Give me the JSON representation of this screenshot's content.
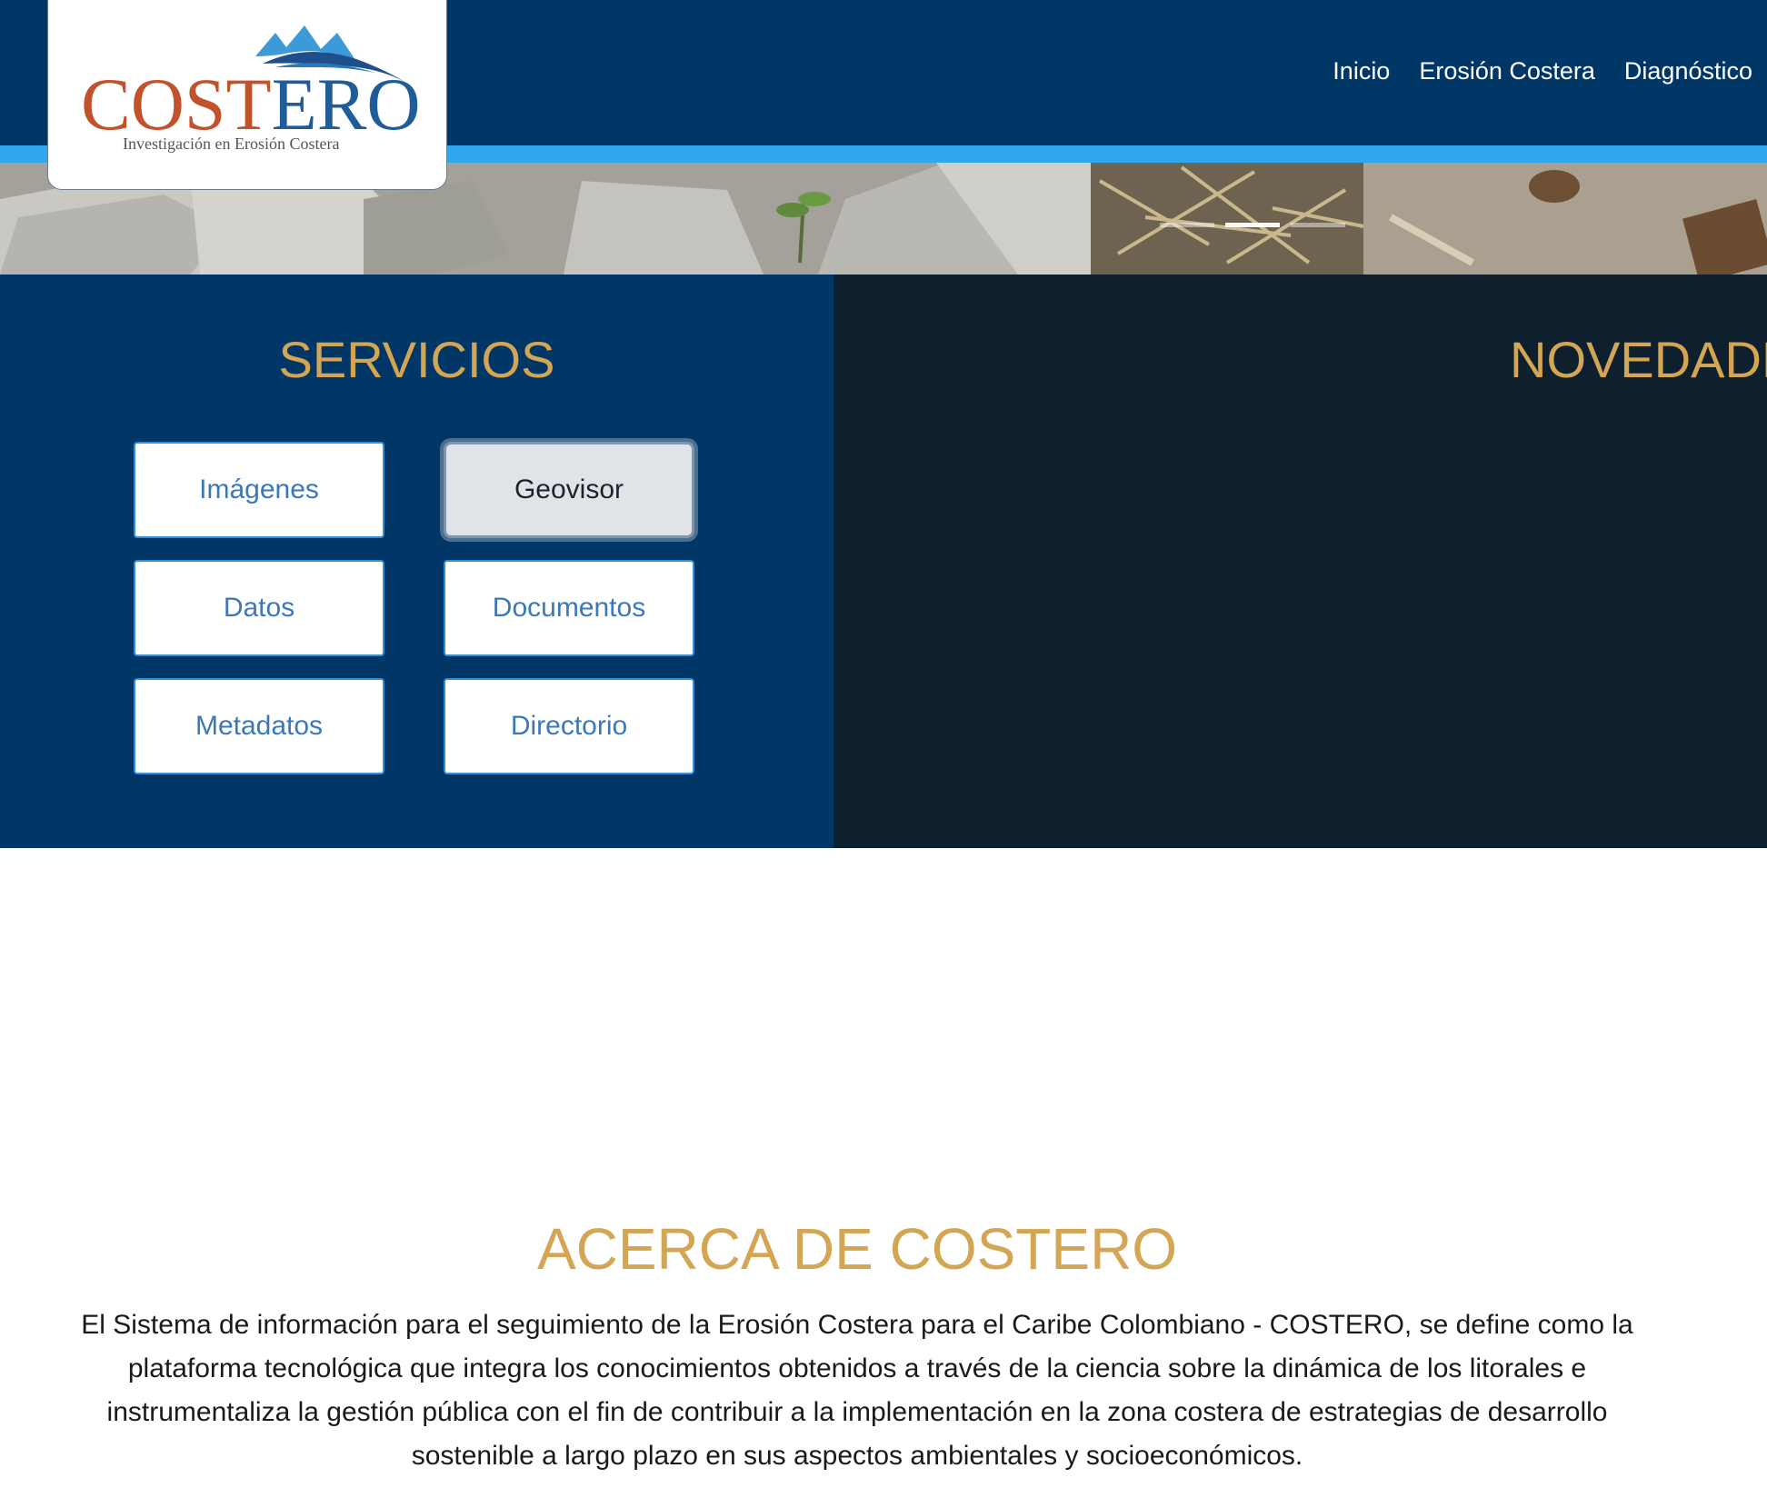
{
  "header": {
    "logo": {
      "name": "COSTERO",
      "tagline": "Investigación en Erosión Costera",
      "colors": {
        "orange": "#c2522a",
        "blue": "#1f5c9a",
        "light_blue": "#3d9ad8"
      }
    },
    "nav": [
      {
        "label": "Inicio"
      },
      {
        "label": "Erosión Costera"
      },
      {
        "label": "Diagnóstico"
      }
    ],
    "colors": {
      "bar": "#013766",
      "stripe": "#2fa7ef"
    }
  },
  "hero": {
    "slide_count": 3,
    "active_slide": 2
  },
  "services": {
    "title": "SERVICIOS",
    "buttons": [
      {
        "label": "Imágenes"
      },
      {
        "label": "Geovisor",
        "state": "focused"
      },
      {
        "label": "Datos"
      },
      {
        "label": "Documentos"
      },
      {
        "label": "Metadatos"
      },
      {
        "label": "Directorio"
      }
    ]
  },
  "news": {
    "title": "NOVEDADES"
  },
  "about": {
    "title": "ACERCA DE COSTERO",
    "text": "El Sistema de información para el seguimiento de la Erosión Costera para el Caribe Colombiano - COSTERO, se define como la plataforma tecnológica que integra los conocimientos obtenidos a través de la ciencia sobre la dinámica de los litorales e instrumentaliza la gestión pública con el fin de contribuir a la implementación en la zona costera de estrategias de desarrollo sostenible a largo plazo en sus aspectos ambientales y socioeconómicos."
  },
  "theme": {
    "gold": "#d4a653",
    "dark_panel": "#0e1f2d",
    "button_text": "#3b78b9"
  }
}
